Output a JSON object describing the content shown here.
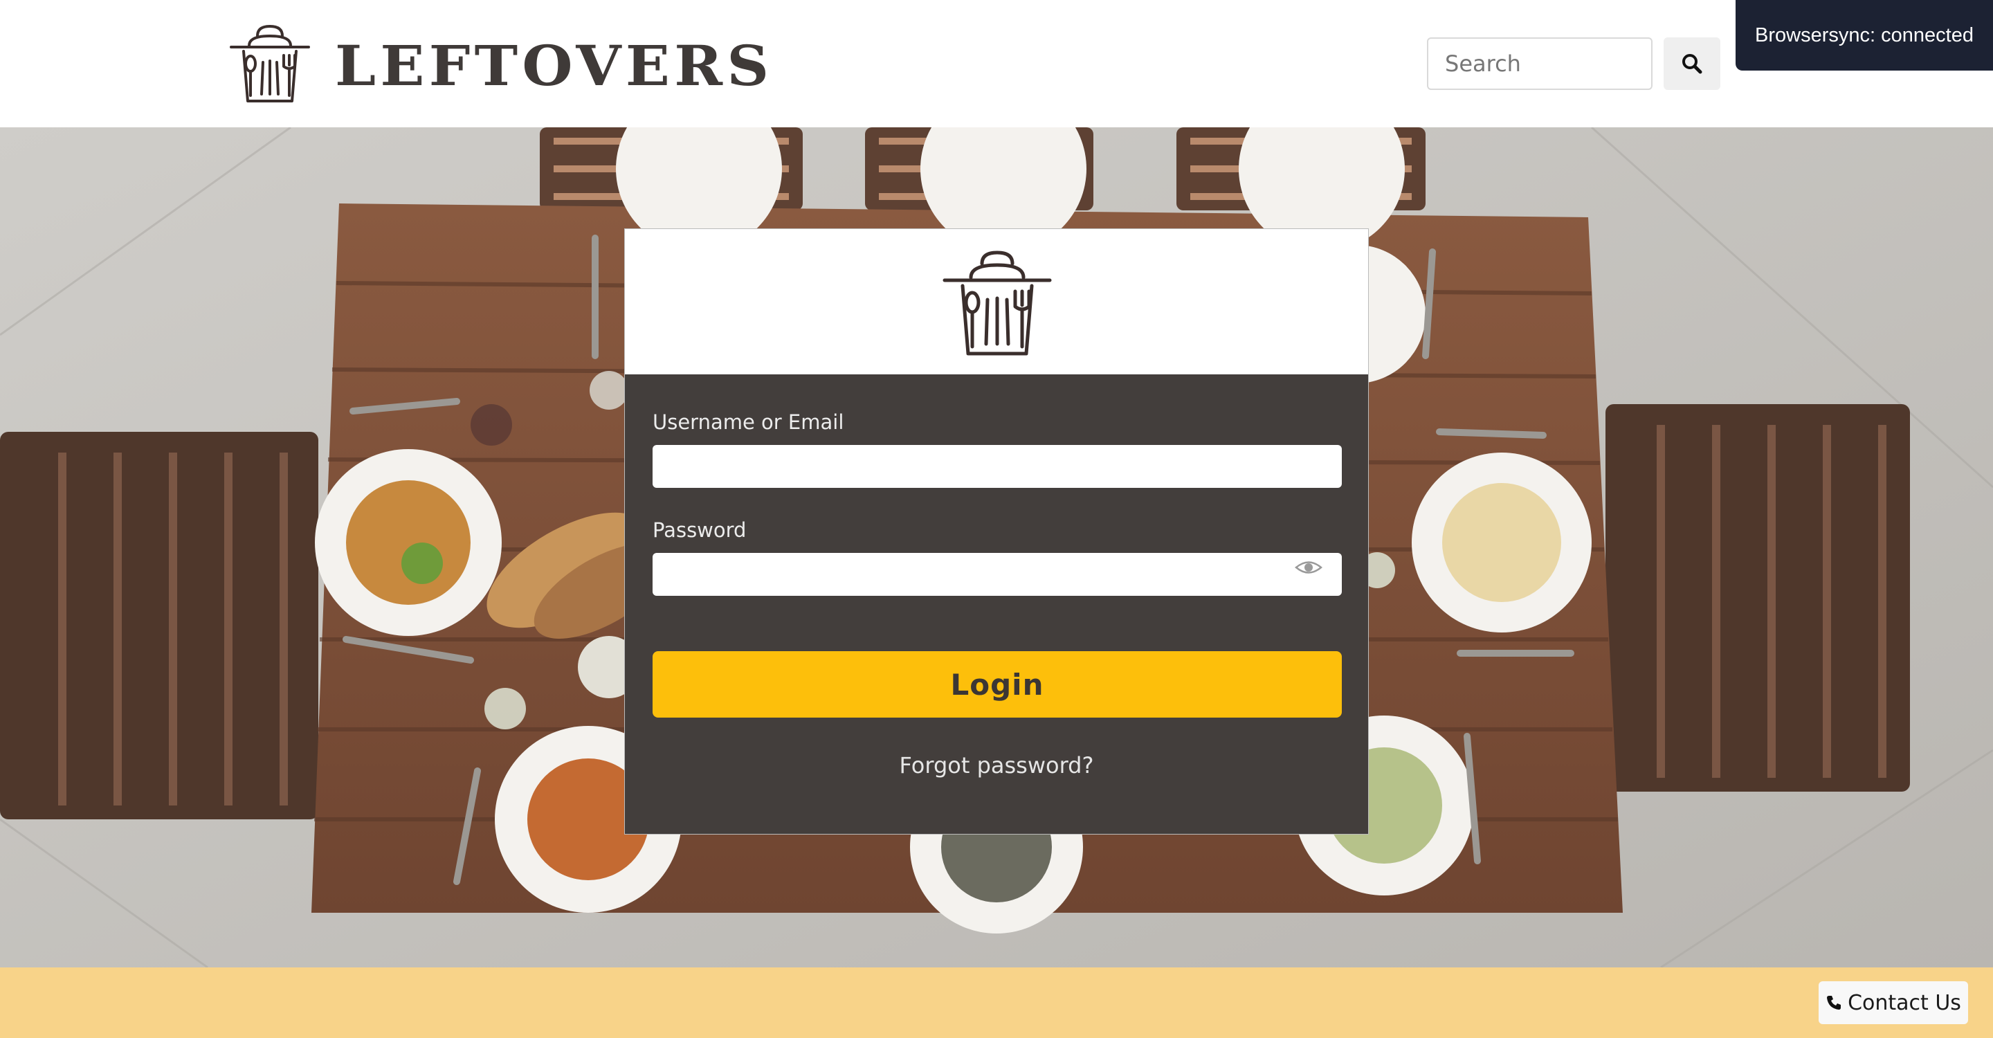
{
  "header": {
    "brand": "LEFTOVERS",
    "search_placeholder": "Search",
    "search_icon": "search-icon"
  },
  "browsersync": {
    "status": "Browsersync: connected"
  },
  "login": {
    "username_label": "Username or Email",
    "username_value": "",
    "password_label": "Password",
    "password_value": "",
    "password_toggle_icon": "eye-icon",
    "login_label": "Login",
    "forgot_label": "Forgot password?"
  },
  "footer": {
    "contact_label": "Contact Us",
    "contact_icon": "phone-icon"
  },
  "colors": {
    "accent": "#fdbf0b",
    "card_bg": "#433e3c",
    "footer_bg": "#f8d389",
    "badge_bg": "#1c2233",
    "brand_text": "#3f3a38"
  }
}
